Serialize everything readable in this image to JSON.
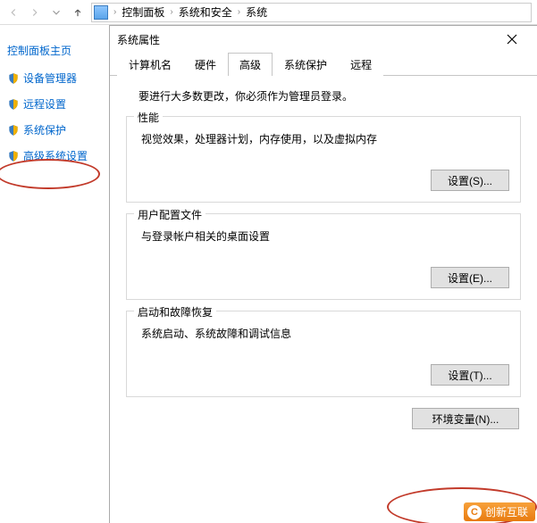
{
  "addressbar": {
    "crumbs": [
      "控制面板",
      "系统和安全",
      "系统"
    ]
  },
  "sidebar": {
    "title": "控制面板主页",
    "items": [
      {
        "label": "设备管理器"
      },
      {
        "label": "远程设置"
      },
      {
        "label": "系统保护"
      },
      {
        "label": "高级系统设置"
      }
    ]
  },
  "dialog": {
    "title": "系统属性",
    "tabs": [
      {
        "label": "计算机名"
      },
      {
        "label": "硬件"
      },
      {
        "label": "高级"
      },
      {
        "label": "系统保护"
      },
      {
        "label": "远程"
      }
    ],
    "active_tab_index": 2,
    "admin_note": "要进行大多数更改，你必须作为管理员登录。",
    "groups": {
      "performance": {
        "legend": "性能",
        "desc": "视觉效果，处理器计划，内存使用，以及虚拟内存",
        "button": "设置(S)..."
      },
      "userprofile": {
        "legend": "用户配置文件",
        "desc": "与登录帐户相关的桌面设置",
        "button": "设置(E)..."
      },
      "startup": {
        "legend": "启动和故障恢复",
        "desc": "系统启动、系统故障和调试信息",
        "button": "设置(T)..."
      }
    },
    "env_button": "环境变量(N)..."
  },
  "watermark": {
    "text": "创新互联"
  }
}
